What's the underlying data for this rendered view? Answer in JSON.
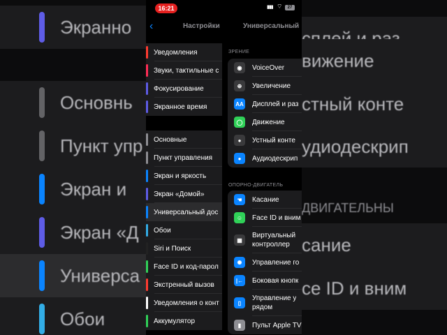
{
  "status": {
    "time": "16:21",
    "battery": "27"
  },
  "left_nav": {
    "back": "‹",
    "title": "Настройки"
  },
  "right_nav": {
    "title": "Универсальный"
  },
  "left_group1": [
    {
      "label": "Уведомления",
      "color": "#ff3b30"
    },
    {
      "label": "Звуки, тактильные с",
      "color": "#ff2d55"
    },
    {
      "label": "Фокусирование",
      "color": "#5e5ce6"
    },
    {
      "label": "Экранное время",
      "color": "#5e5ce6"
    }
  ],
  "left_group2": [
    {
      "label": "Основные",
      "color": "#8e8e93"
    },
    {
      "label": "Пункт управления",
      "color": "#8e8e93"
    },
    {
      "label": "Экран и яркость",
      "color": "#0a84ff"
    },
    {
      "label": "Экран «Домой»",
      "color": "#5e5ce6"
    },
    {
      "label": "Универсальный дос",
      "color": "#0a84ff"
    },
    {
      "label": "Обои",
      "color": "#32ade6"
    },
    {
      "label": "Siri и Поиск",
      "color": "#222"
    },
    {
      "label": "Face ID и код-парол",
      "color": "#30d158"
    },
    {
      "label": "Экстренный вызов",
      "color": "#ff3b30"
    },
    {
      "label": "Уведомления о конт",
      "color": "#ffffff"
    },
    {
      "label": "Аккумулятор",
      "color": "#30d158"
    }
  ],
  "vision_section": {
    "header": "ЗРЕНИЕ",
    "items": [
      {
        "label": "VoiceOver",
        "icon": "voiceover-icon",
        "icon_color": "#3a3a3c",
        "glyph": "◉"
      },
      {
        "label": "Увеличение",
        "icon": "zoom-icon",
        "icon_color": "#3a3a3c",
        "glyph": "⊕"
      },
      {
        "label": "Дисплей и раз",
        "icon": "text-size-icon",
        "icon_color": "#0a84ff",
        "glyph": "AA"
      },
      {
        "label": "Движение",
        "icon": "motion-icon",
        "icon_color": "#30d158",
        "glyph": "◯"
      },
      {
        "label": "Устный конте",
        "icon": "spoken-content-icon",
        "icon_color": "#3a3a3c",
        "glyph": "●"
      },
      {
        "label": "Аудиодескрип",
        "icon": "audio-description-icon",
        "icon_color": "#0a84ff",
        "glyph": "●"
      }
    ]
  },
  "motor_section": {
    "header": "ОПОРНО-ДВИГАТЕЛЬ",
    "items": [
      {
        "label": "Касание",
        "icon": "touch-icon",
        "icon_color": "#0a84ff",
        "glyph": "☚"
      },
      {
        "label": "Face ID и вним",
        "icon": "face-id-icon",
        "icon_color": "#30d158",
        "glyph": "☺"
      },
      {
        "label1": "Виртуальный",
        "label2": "контроллер",
        "icon": "switch-control-icon",
        "icon_color": "#3a3a3c",
        "glyph": "▦"
      },
      {
        "label": "Управление го",
        "icon": "voice-control-icon",
        "icon_color": "#0a84ff",
        "glyph": "✺"
      },
      {
        "label": "Боковая кнопк",
        "icon": "side-button-icon",
        "icon_color": "#0a84ff",
        "glyph": "|←"
      },
      {
        "label1": "Управление у",
        "label2": "рядом",
        "icon": "nearby-devices-icon",
        "icon_color": "#0a84ff",
        "glyph": "▯"
      },
      {
        "label": "Пульт Apple TV",
        "icon": "apple-tv-remote-icon",
        "icon_color": "#8e8e93",
        "glyph": "▮"
      }
    ]
  },
  "backdrop_left": [
    "Экранно",
    "Основнь",
    "Пункт упр",
    "Экран и",
    "Экран «Д",
    "Универса",
    "Обои"
  ],
  "backdrop_right": [
    "сплей и раз",
    "вижение",
    "стный конте",
    "удиодескрип",
    "ДВИГАТЕЛЬНЫ",
    "сание",
    "ce ID и вним"
  ]
}
